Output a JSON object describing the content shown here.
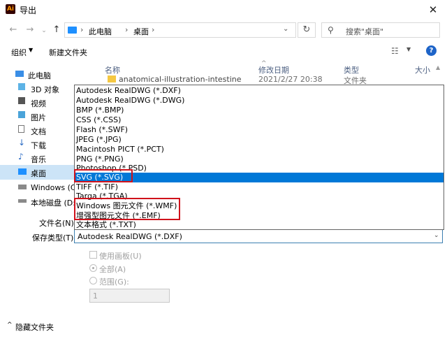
{
  "window": {
    "title": "导出",
    "app_icon": "Ai",
    "close": "✕"
  },
  "nav": {
    "back": "←",
    "forward": "→",
    "dropdown": "⌄",
    "up": "↑"
  },
  "address": {
    "sep": "›",
    "segments": [
      "此电脑",
      "桌面"
    ],
    "drop": "⌄"
  },
  "search": {
    "placeholder": "搜索\"桌面\""
  },
  "toolbar": {
    "organize": "组织",
    "organize_caret": "▼",
    "new_folder": "新建文件夹",
    "view_caret": "▼",
    "help": "?"
  },
  "sidebar": {
    "items": [
      {
        "label": "此电脑",
        "icon": "computer-icon"
      },
      {
        "label": "3D 对象",
        "icon": "cube-icon"
      },
      {
        "label": "视频",
        "icon": "video-icon"
      },
      {
        "label": "图片",
        "icon": "picture-icon"
      },
      {
        "label": "文档",
        "icon": "document-icon"
      },
      {
        "label": "下载",
        "icon": "download-icon"
      },
      {
        "label": "音乐",
        "icon": "music-icon"
      },
      {
        "label": "桌面",
        "icon": "desktop-icon"
      },
      {
        "label": "Windows (C:",
        "icon": "windows-drive-icon"
      },
      {
        "label": "本地磁盘 (D:",
        "icon": "disk-icon"
      }
    ]
  },
  "filelist": {
    "columns": [
      "名称",
      "修改日期",
      "类型",
      "大小"
    ],
    "sort_arrow": "^",
    "rows": [
      {
        "name": "anatomical-illustration-intestine",
        "date": "2021/2/27 20:38",
        "type": "文件夹"
      }
    ]
  },
  "fields": {
    "filename_label": "文件名(N):",
    "type_label": "保存类型(T):",
    "type_value": "Autodesk RealDWG (*.DXF)",
    "type_caret": "⌄"
  },
  "dropdown": {
    "options": [
      "Autodesk RealDWG (*.DXF)",
      "Autodesk RealDWG (*.DWG)",
      "BMP (*.BMP)",
      "CSS (*.CSS)",
      "Flash (*.SWF)",
      "JPEG (*.JPG)",
      "Macintosh PICT (*.PCT)",
      "PNG (*.PNG)",
      "Photoshop (*.PSD)",
      "SVG (*.SVG)",
      "TIFF (*.TIF)",
      "Targa (*.TGA)",
      "Windows 图元文件 (*.WMF)",
      "增强型图元文件 (*.EMF)",
      "文本格式 (*.TXT)"
    ],
    "selected": "SVG (*.SVG)"
  },
  "options": {
    "use_artboards": "使用画板(U)",
    "all": "全部(A)",
    "range": "范围(G):",
    "range_value": "1"
  },
  "footer": {
    "hide_folders": "隐藏文件夹",
    "caret": "^"
  },
  "colors": {
    "accent": "#0078d7",
    "highlight_box": "#d0121b",
    "sidebar_selected": "#cce4f7"
  }
}
